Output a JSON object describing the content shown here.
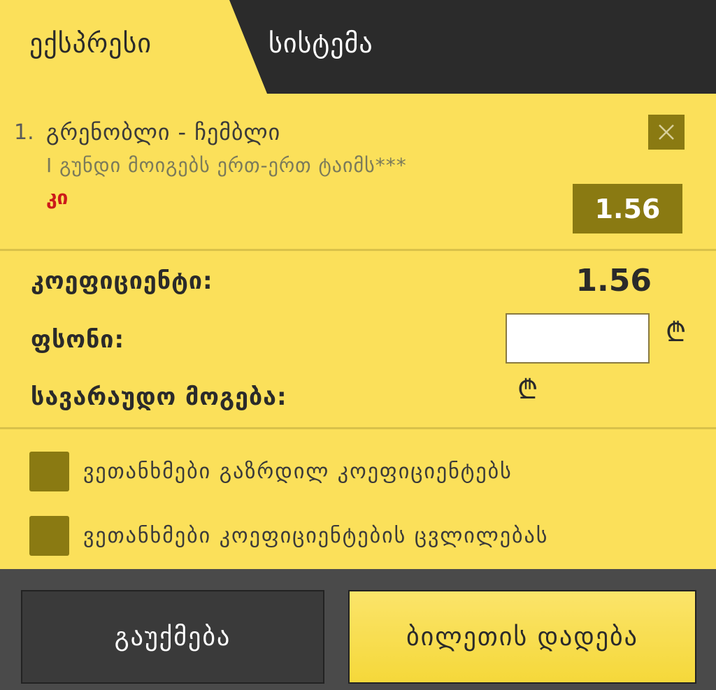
{
  "tabs": {
    "express": "ექსპრესი",
    "system": "სისტემა"
  },
  "bet": {
    "index": "1.",
    "match": "გრენობლი - ჩემბლი",
    "market": "I გუნდი მოიგებს ერთ-ერთ ტაიმს***",
    "pick": "კი",
    "odd": "1.56"
  },
  "summary": {
    "coefficient_label": "კოეფიციენტი:",
    "coefficient_value": "1.56",
    "stake_label": "ფსონი:",
    "stake_value": "",
    "currency_symbol": "₾",
    "potential_win_label": "სავარაუდო მოგება:"
  },
  "agreements": [
    {
      "label": "ვეთანხმები გაზრდილ კოეფიციენტებს"
    },
    {
      "label": "ვეთანხმები კოეფიციენტების ცვლილებას"
    }
  ],
  "footer": {
    "cancel_label": "გაუქმება",
    "place_label": "ბილეთის დადება"
  },
  "colors": {
    "background": "#fbe05a",
    "dark": "#2b2b2b",
    "accent": "#8a7a12",
    "pick": "#cc1a1a"
  }
}
